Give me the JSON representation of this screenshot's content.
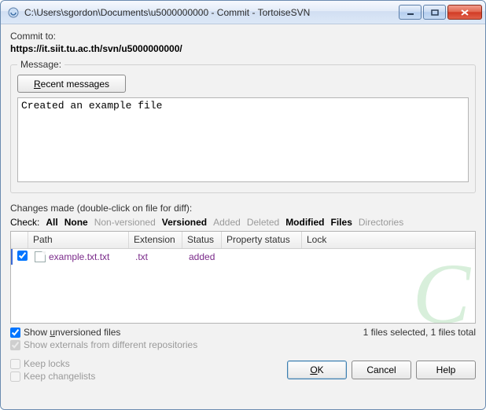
{
  "window": {
    "title": "C:\\Users\\sgordon\\Documents\\u5000000000 - Commit - TortoiseSVN"
  },
  "commit_to": {
    "label": "Commit to:",
    "url": "https://it.siit.tu.ac.th/svn/u5000000000/"
  },
  "message": {
    "legend": "Message:",
    "recent_prefix": "R",
    "recent_rest": "ecent messages",
    "text": "Created an example file"
  },
  "changes": {
    "label": "Changes made (double-click on file for diff):",
    "checkbar": {
      "label": "Check:",
      "all": "All",
      "none": "None",
      "nonversioned": "Non-versioned",
      "versioned": "Versioned",
      "added": "Added",
      "deleted": "Deleted",
      "modified": "Modified",
      "files": "Files",
      "directories": "Directories"
    },
    "columns": {
      "path": "Path",
      "extension": "Extension",
      "status": "Status",
      "property_status": "Property status",
      "lock": "Lock"
    },
    "rows": [
      {
        "checked": true,
        "path": "example.txt.txt",
        "extension": ".txt",
        "status": "added",
        "property_status": "",
        "lock": ""
      }
    ],
    "status": "1 files selected, 1 files total"
  },
  "options": {
    "show_unversioned_pre": "Show ",
    "show_unversioned_ul": "u",
    "show_unversioned_post": "nversioned files",
    "show_externals": "Show externals from different repositories",
    "keep_locks": "Keep locks",
    "keep_changelists": "Keep changelists"
  },
  "buttons": {
    "ok_ul": "O",
    "ok_rest": "K",
    "cancel": "Cancel",
    "help": "Help"
  }
}
